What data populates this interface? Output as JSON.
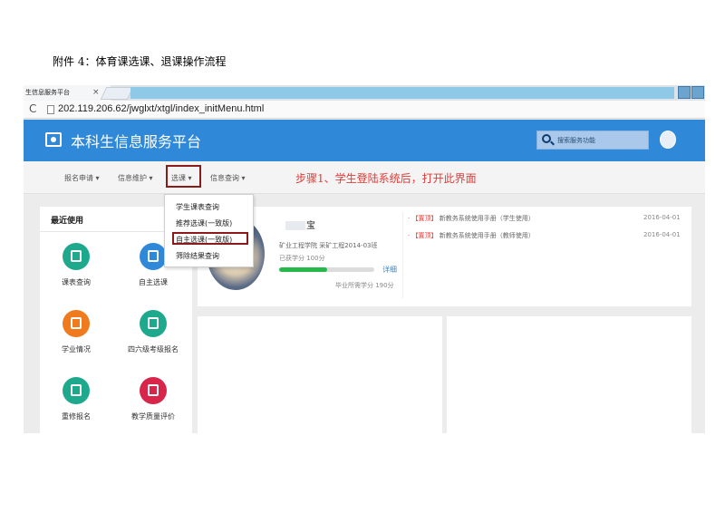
{
  "doc": {
    "heading": "附件 4：体育课选课、退课操作流程"
  },
  "browser": {
    "tab_title": "生信息服务平台",
    "tab_close": "×",
    "url": "202.119.206.62/jwglxt/xtgl/index_initMenu.html"
  },
  "header": {
    "title": "本科生信息服务平台",
    "search_placeholder": "搜索服务功能",
    "brand_color": "#2f89d8"
  },
  "nav": {
    "items": [
      "报名申请 ▾",
      "信息维护 ▾",
      "选课 ▾",
      "信息查询 ▾"
    ],
    "annotation": "步骤1、学生登陆系统后，打开此界面"
  },
  "dropdown": {
    "items": [
      "学生课表查询",
      "推荐选课(一致版)",
      "自主选课(一致版)",
      "筛除结果查询"
    ]
  },
  "recent": {
    "title": "最近使用",
    "tiles": [
      {
        "label": "课表查询",
        "color": "#1fa98c",
        "icon": "table-icon"
      },
      {
        "label": "自主选课",
        "color": "#2f89d8",
        "icon": "select-icon"
      },
      {
        "label": "学业情况",
        "color": "#f07a1e",
        "icon": "hand-icon"
      },
      {
        "label": "四六级考级报名",
        "color": "#1fa98c",
        "icon": "exam-icon"
      },
      {
        "label": "重修报名",
        "color": "#1fa98c",
        "icon": "book-icon"
      },
      {
        "label": "教学质量评价",
        "color": "#d8254a",
        "icon": "evaluation-icon"
      }
    ]
  },
  "profile": {
    "name": "宝",
    "class": "矿业工程学院 采矿工程2014-03班",
    "credits": "已获学分 100分",
    "progress": 0.5,
    "detail": "详细",
    "required": "毕业所需学分 190分"
  },
  "news": [
    {
      "bullet": "·",
      "tag": "【置顶】",
      "text": "新教务系统使用手册（学生使用）",
      "date": "2016-04-01"
    },
    {
      "bullet": "·",
      "tag": "【置顶】",
      "text": "新教务系统使用手册（教师使用）",
      "date": "2016-04-01"
    }
  ]
}
